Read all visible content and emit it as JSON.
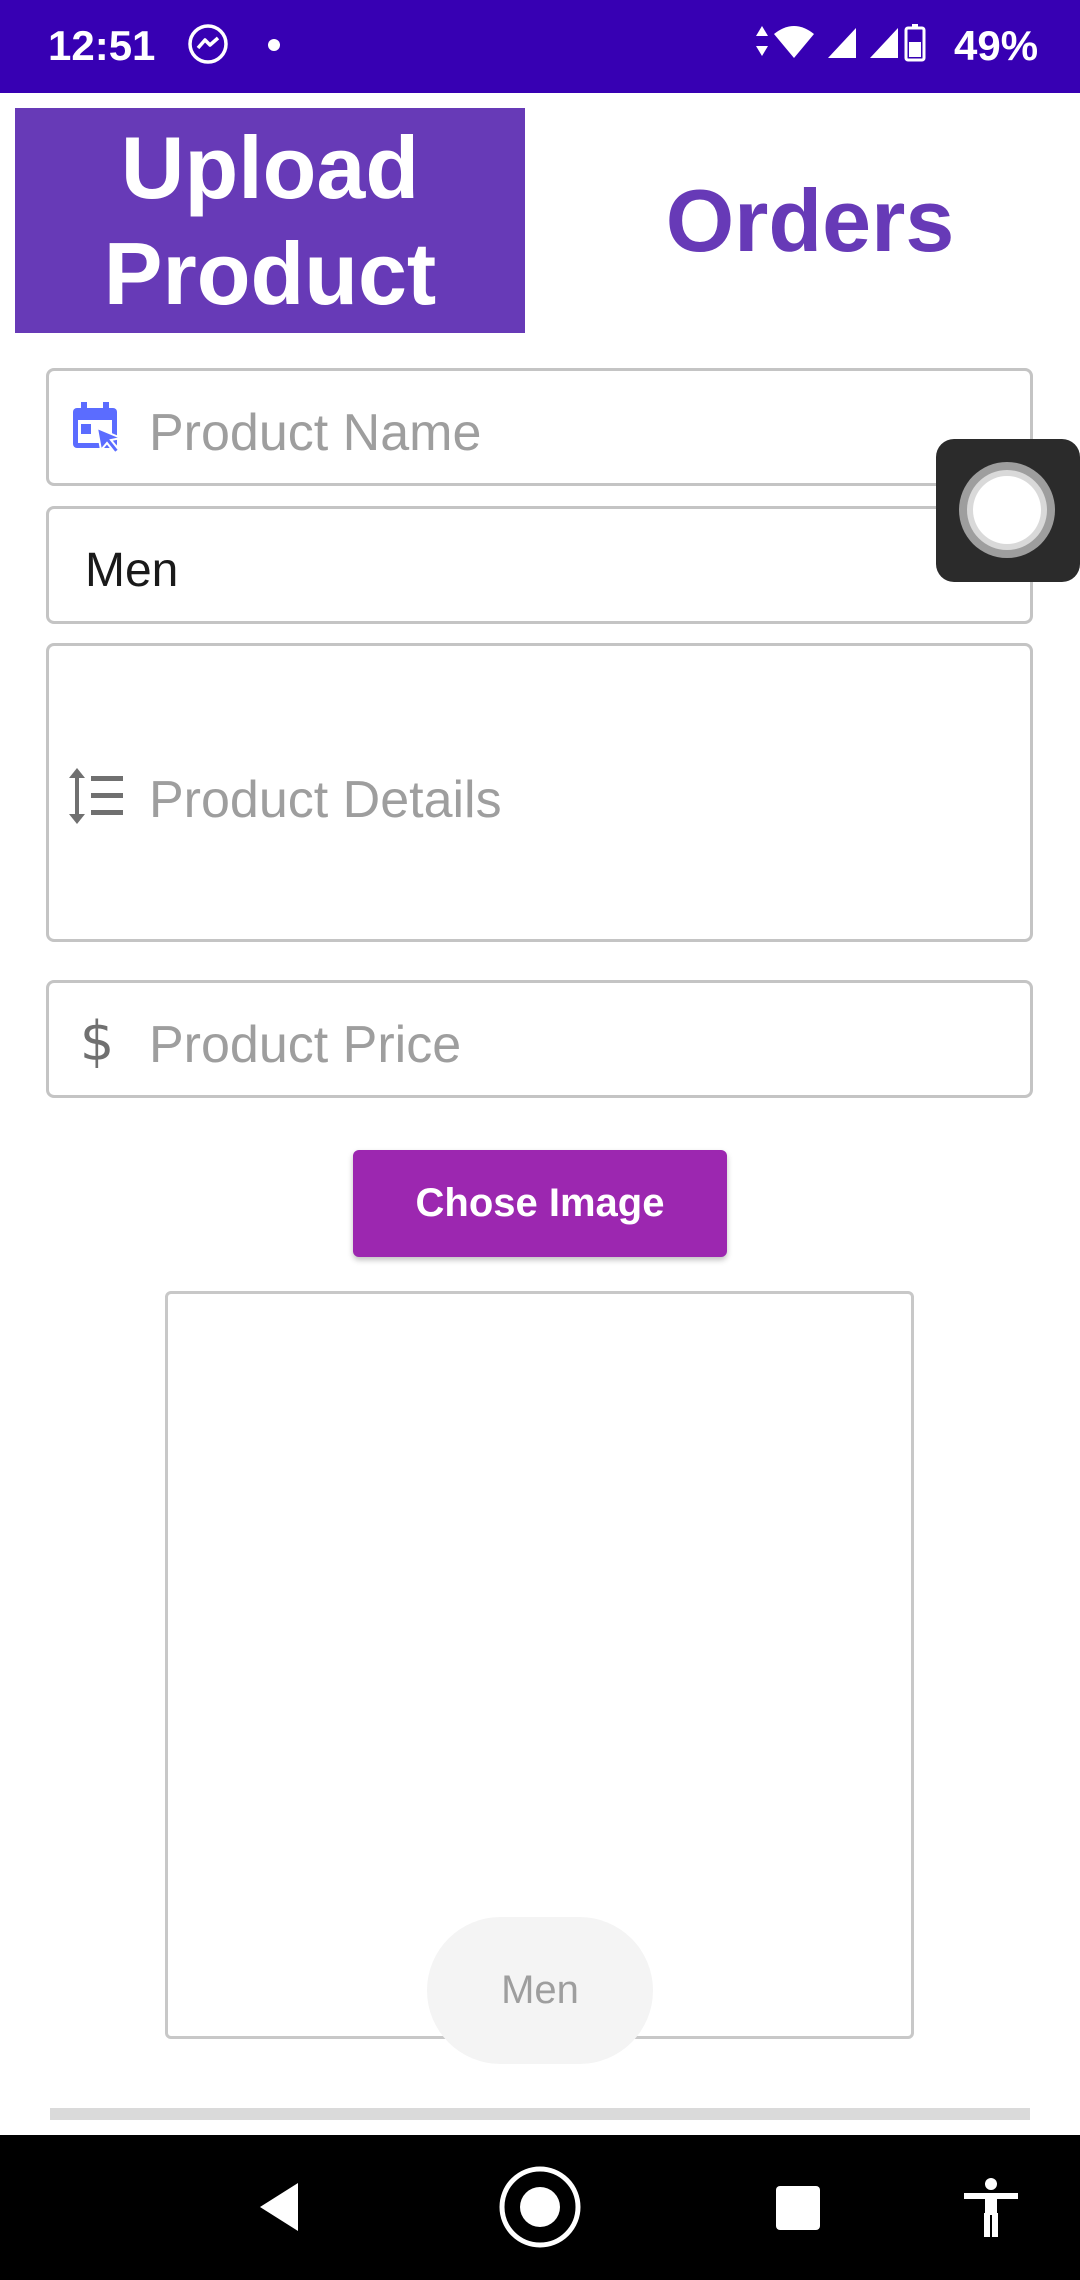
{
  "status_bar": {
    "time": "12:51",
    "battery": "49%",
    "icons": [
      "messenger-icon",
      "dot",
      "data-arrows-icon",
      "wifi-icon",
      "signal-icon",
      "signal-icon",
      "battery-icon"
    ]
  },
  "tabs": {
    "upload_label": "Upload\nProduct",
    "orders_label": "Orders"
  },
  "form": {
    "product_name_placeholder": "Product Name",
    "category_value": "Men",
    "product_details_placeholder": "Product Details",
    "product_price_placeholder": "Product Price",
    "choose_image_label": "Chose Image"
  },
  "toast": {
    "text": "Men"
  },
  "colors": {
    "status_bar": "#3700b3",
    "primary": "#673ab7",
    "accent_button": "#9c27b0",
    "icon_blue": "#5b6cff"
  },
  "nav_bar": {
    "icons": [
      "back-icon",
      "home-icon",
      "recents-icon",
      "accessibility-icon"
    ]
  }
}
